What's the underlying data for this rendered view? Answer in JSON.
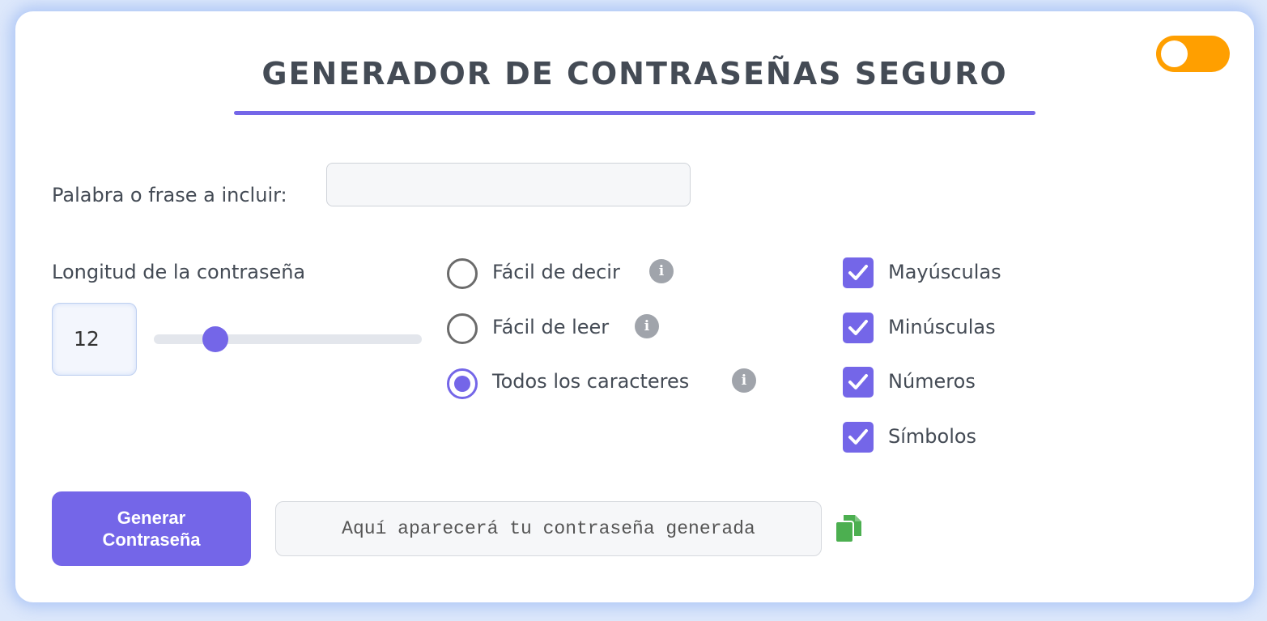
{
  "header": {
    "title": "GENERADOR DE CONTRASEÑAS SEGURO",
    "theme_toggle": {
      "icon": "theme-toggle",
      "state": "on",
      "color": "#ff9f00"
    }
  },
  "phrase": {
    "label": "Palabra o frase a incluir:",
    "value": "",
    "placeholder": ""
  },
  "length": {
    "label": "Longitud de la contraseña",
    "value": "12",
    "slider_fraction": 0.2
  },
  "modes": [
    {
      "label": "Fácil de decir",
      "checked": false,
      "icon": "info-icon"
    },
    {
      "label": "Fácil de leer",
      "checked": false,
      "icon": "info-icon"
    },
    {
      "label": "Todos los caracteres",
      "checked": true,
      "icon": "info-icon"
    }
  ],
  "options": [
    {
      "label": "Mayúsculas",
      "checked": true
    },
    {
      "label": "Minúsculas",
      "checked": true
    },
    {
      "label": "Números",
      "checked": true
    },
    {
      "label": "Símbolos",
      "checked": true
    }
  ],
  "actions": {
    "generate_label_line1": "Generar",
    "generate_label_line2": "Contraseña",
    "output_placeholder": "Aquí aparecerá tu contraseña generada",
    "copy_icon": "copy-icon"
  },
  "colors": {
    "accent": "#7466e8",
    "toggle": "#ff9f00",
    "copy": "#4caf50",
    "text": "#444b55"
  }
}
